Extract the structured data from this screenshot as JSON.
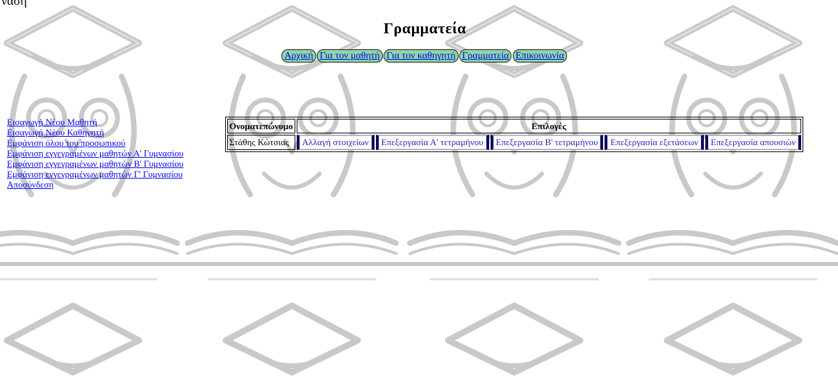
{
  "partial_top_text": "ναση",
  "page": {
    "title": "Γραμματεία"
  },
  "nav": {
    "items": [
      {
        "label": "Αρχική"
      },
      {
        "label": "Για τον μαθητή"
      },
      {
        "label": "Για τον καθηγητή"
      },
      {
        "label": "Γραμματεία"
      },
      {
        "label": "Επικοινωνία"
      }
    ]
  },
  "sidebar": {
    "links": [
      {
        "label": "Εισαγωγή Νέου Μαθητή"
      },
      {
        "label": "Εισαγωγή Νέου Καθηγητή"
      },
      {
        "label": "Εμφάνιση όλου του προσωπικού"
      },
      {
        "label": "Εμφάνιση εγγεγραμένων μαθητών Α' Γυμνασίου"
      },
      {
        "label": "Εμφάνιση εγγεγραμένων μαθητών Β' Γυμνασίου"
      },
      {
        "label": "Εμφάνιση εγγεγραμένων μαθητών Γ' Γυμνασίου"
      },
      {
        "label": "Αποσύνδεση"
      }
    ]
  },
  "table": {
    "headers": {
      "name": "Ονοματεπώνυμο",
      "options": "Επιλογές"
    },
    "rows": [
      {
        "name": "Στάθης Κώτσιας",
        "buttons": [
          "Αλλαγή στοιχείων",
          "Επεξεργασία Α' τετραμήνου",
          "Επεξεργασία Β' τετραμήνου",
          "Επεξεργασία εξετάσεων",
          "Επεξεργασία απουσιών"
        ]
      }
    ]
  },
  "background": {
    "motif": "graduation-cap-owl-book-watermark",
    "line_color": "#c8c8c8"
  }
}
